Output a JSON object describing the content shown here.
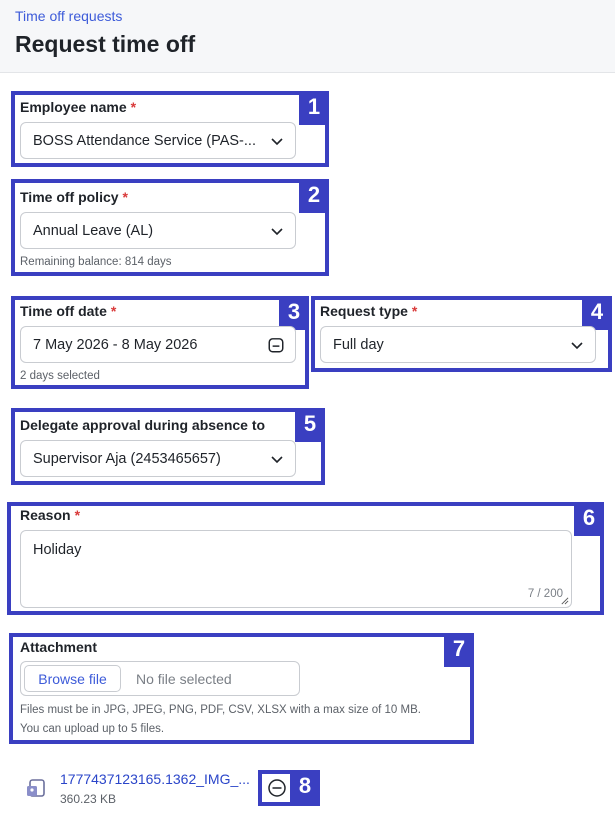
{
  "header": {
    "breadcrumb": "Time off requests",
    "title": "Request time off"
  },
  "callouts": [
    "1",
    "2",
    "3",
    "4",
    "5",
    "6",
    "7",
    "8"
  ],
  "employee": {
    "label": "Employee name",
    "required": "*",
    "value": "BOSS Attendance Service (PAS-..."
  },
  "policy": {
    "label": "Time off policy",
    "required": "*",
    "value": "Annual Leave (AL)",
    "hint": "Remaining balance: 814 days"
  },
  "date": {
    "label": "Time off date",
    "required": "*",
    "value": "7 May 2026 - 8 May 2026",
    "hint": "2 days selected"
  },
  "request_type": {
    "label": "Request type",
    "required": "*",
    "value": "Full day"
  },
  "delegate": {
    "label": "Delegate approval during absence to",
    "value": "Supervisor Aja (2453465657)"
  },
  "reason": {
    "label": "Reason",
    "required": "*",
    "value": "Holiday",
    "counter": "7 / 200"
  },
  "attachment": {
    "label": "Attachment",
    "browse_label": "Browse file",
    "status": "No file selected",
    "hint_line1": "Files must be in JPG, JPEG, PNG, PDF, CSV, XLSX with a max size of 10 MB.",
    "hint_line2": "You can upload up to 5 files."
  },
  "file": {
    "name": "1777437123165.1362_IMG_...",
    "size": "360.23 KB"
  },
  "colors": {
    "accent": "#3d5bd9",
    "callout": "#3a3fc1",
    "required": "#d93a3a"
  }
}
